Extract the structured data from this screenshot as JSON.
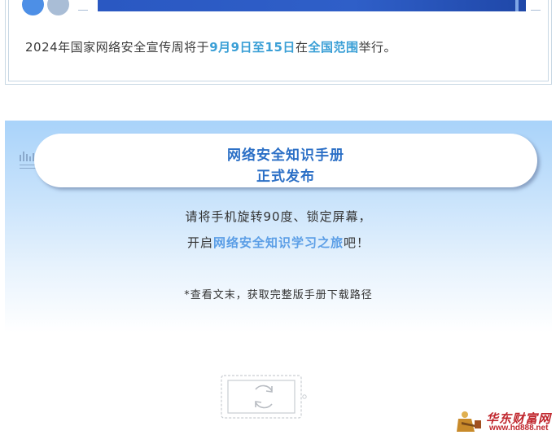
{
  "notice": {
    "segments": [
      {
        "text": "2024年国家网络安全宣传周将于",
        "highlight": false
      },
      {
        "text": "9月9日至15日",
        "highlight": true
      },
      {
        "text": "在",
        "highlight": false
      },
      {
        "text": "全国范围",
        "highlight": true
      },
      {
        "text": "举行。",
        "highlight": false
      }
    ]
  },
  "handbook": {
    "title_line1": "网络安全知识手册",
    "title_line2": "正式发布"
  },
  "instructions": {
    "line1": "请将手机旋转90度、锁定屏幕，",
    "line2_prefix": "开启",
    "line2_highlight": "网络安全知识学习之旅",
    "line2_suffix": "吧！",
    "footnote": "*查看文末，获取完整版手册下载路径"
  },
  "watermark": {
    "brand": "华东财富网",
    "url": "www.hd888.net"
  },
  "icons": {
    "wave": "audio-wave-icon",
    "rotate": "rotate-phone-icon",
    "mascot": "mascot-figure-icon"
  },
  "colors": {
    "accent_blue": "#2b6fc6",
    "highlight_cyan": "#3a9fd6",
    "highlight_blue": "#5b9ee6",
    "watermark_red": "#c0262d"
  }
}
